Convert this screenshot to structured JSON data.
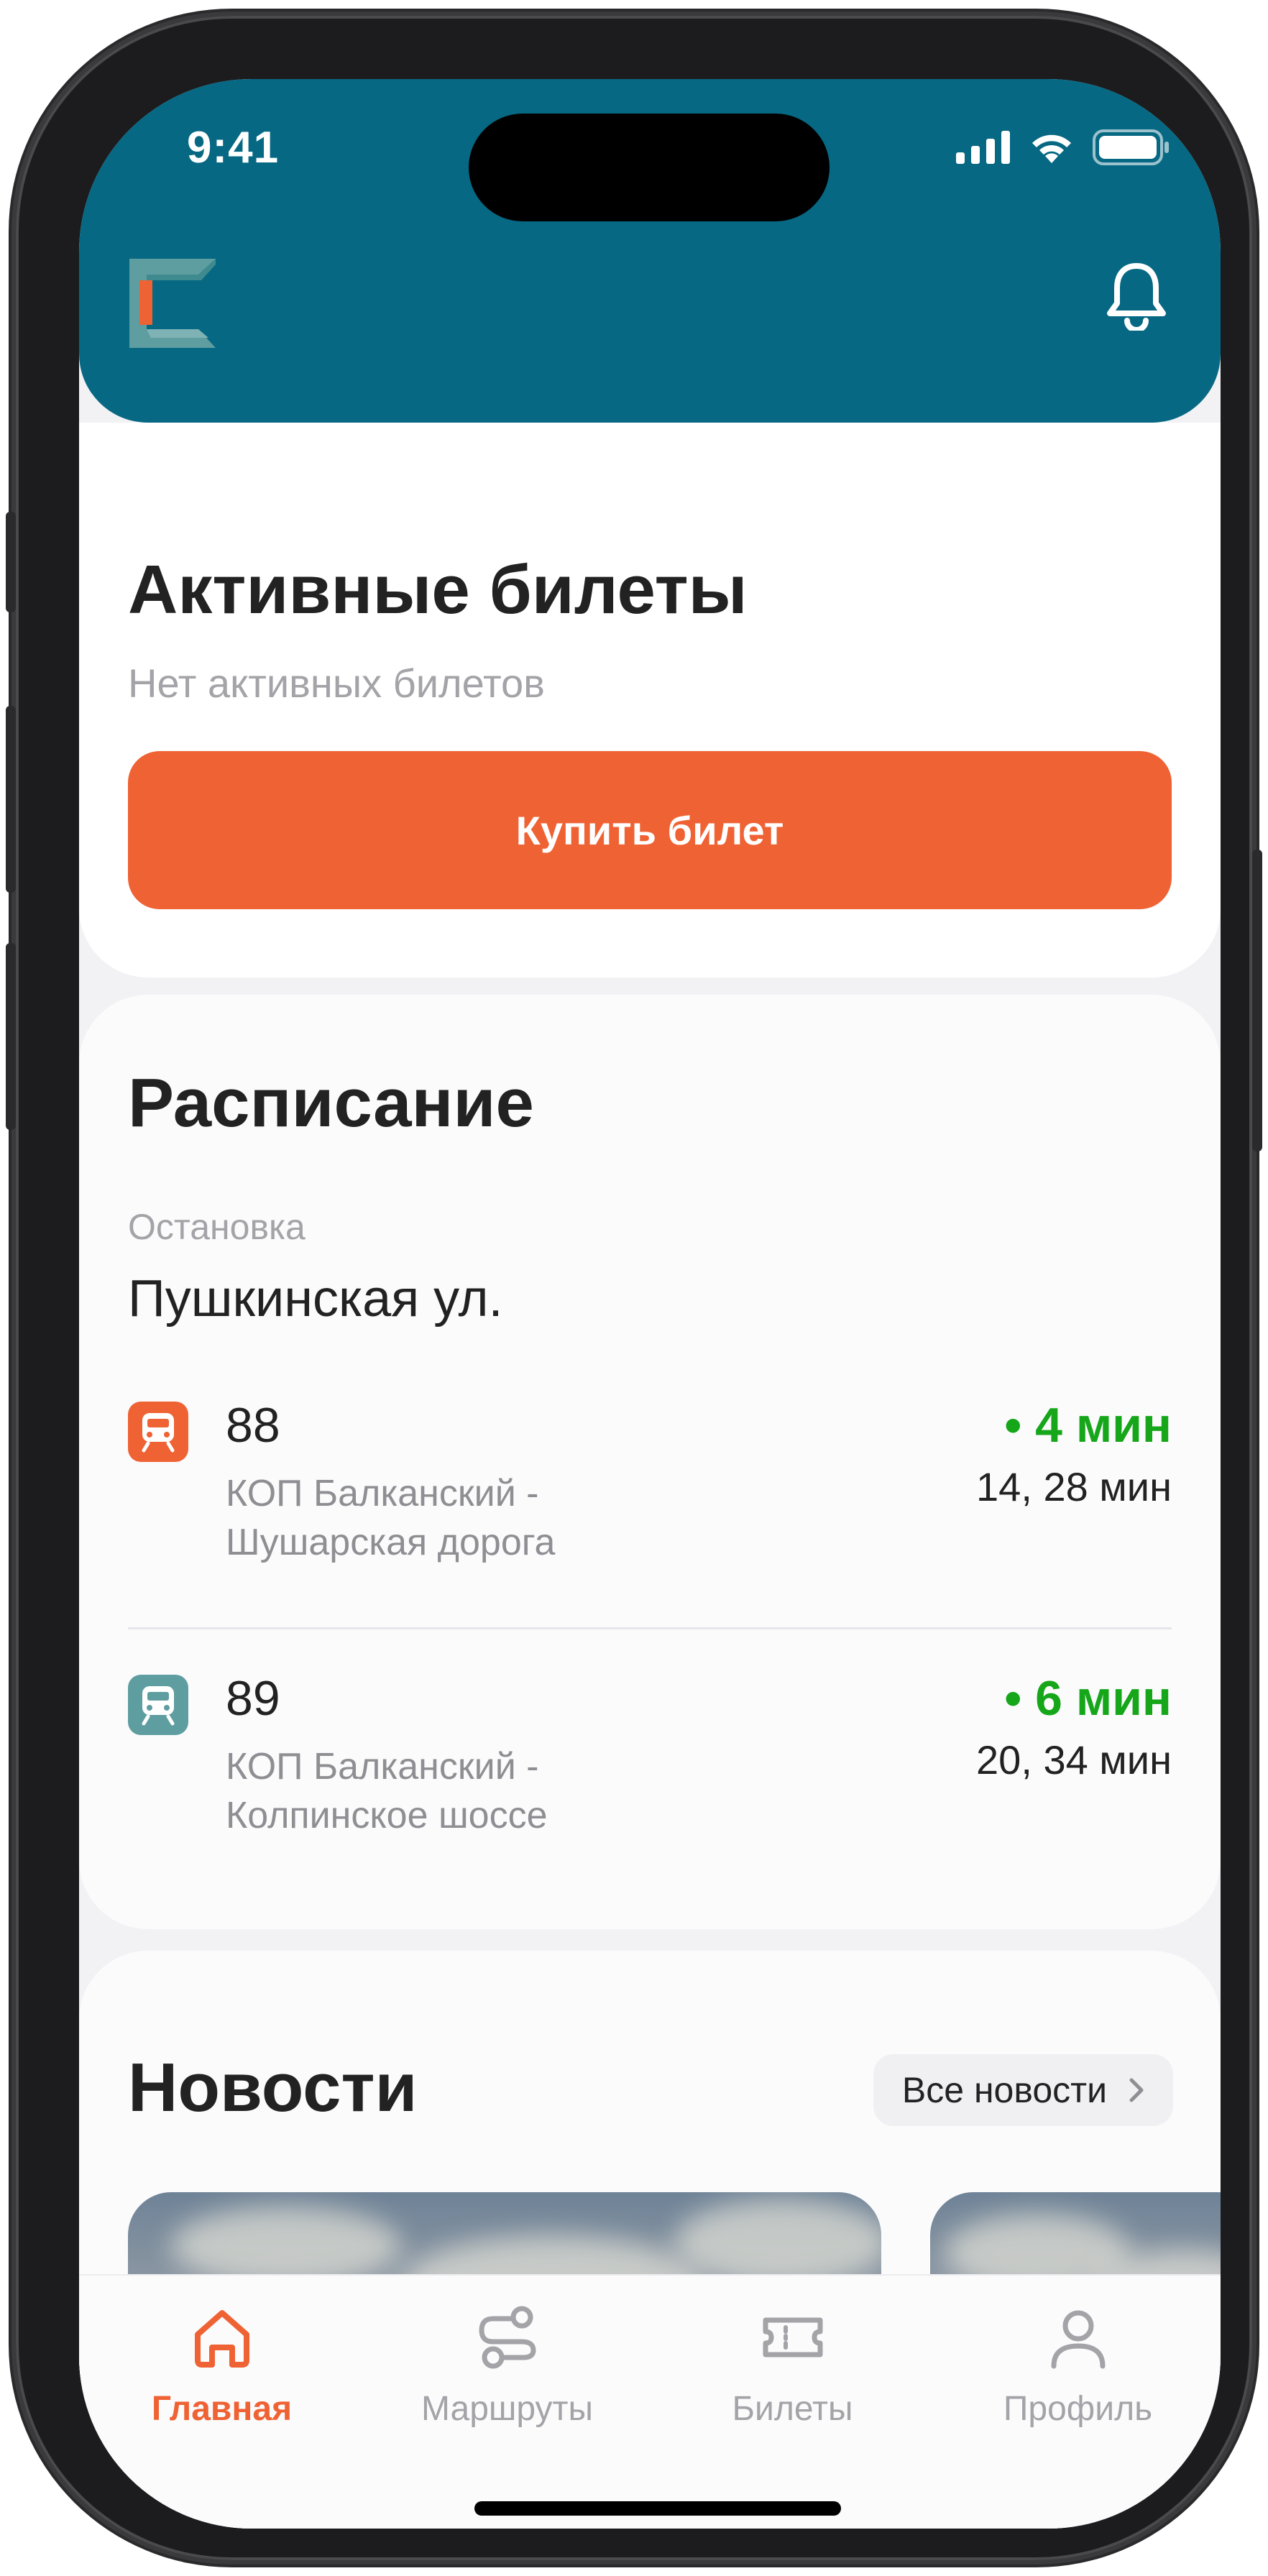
{
  "status_bar": {
    "time": "9:41"
  },
  "header": {
    "logo": "app-logo",
    "bell": "bell-icon"
  },
  "active_tickets": {
    "title": "Активные билеты",
    "subtitle": "Нет активных билетов",
    "buy_button": "Купить билет"
  },
  "schedule": {
    "title": "Расписание",
    "stop_label": "Остановка",
    "stop_name": "Пушкинская ул.",
    "routes": [
      {
        "number": "88",
        "desc_line1": "КОП Балканский -",
        "desc_line2": "Шушарская дорога",
        "eta": "• 4 мин",
        "next": "14, 28 мин",
        "icon_color": "#ef6233",
        "icon": "tram-icon"
      },
      {
        "number": "89",
        "desc_line1": "КОП Балканский -",
        "desc_line2": "Колпинское шоссе",
        "eta": "• 6 мин",
        "next": "20, 34 мин",
        "icon_color": "#5f9ea0",
        "icon": "tram-icon"
      }
    ]
  },
  "news": {
    "title": "Новости",
    "all_news": "Все новости"
  },
  "tabbar": {
    "tabs": [
      {
        "label": "Главная",
        "icon": "home-icon",
        "active": true
      },
      {
        "label": "Маршруты",
        "icon": "routes-icon",
        "active": false
      },
      {
        "label": "Билеты",
        "icon": "ticket-icon",
        "active": false
      },
      {
        "label": "Профиль",
        "icon": "profile-icon",
        "active": false
      }
    ]
  },
  "colors": {
    "header": "#066883",
    "accent": "#ef6233",
    "eta_green": "#16a61a",
    "route_89": "#5f9ea0"
  }
}
